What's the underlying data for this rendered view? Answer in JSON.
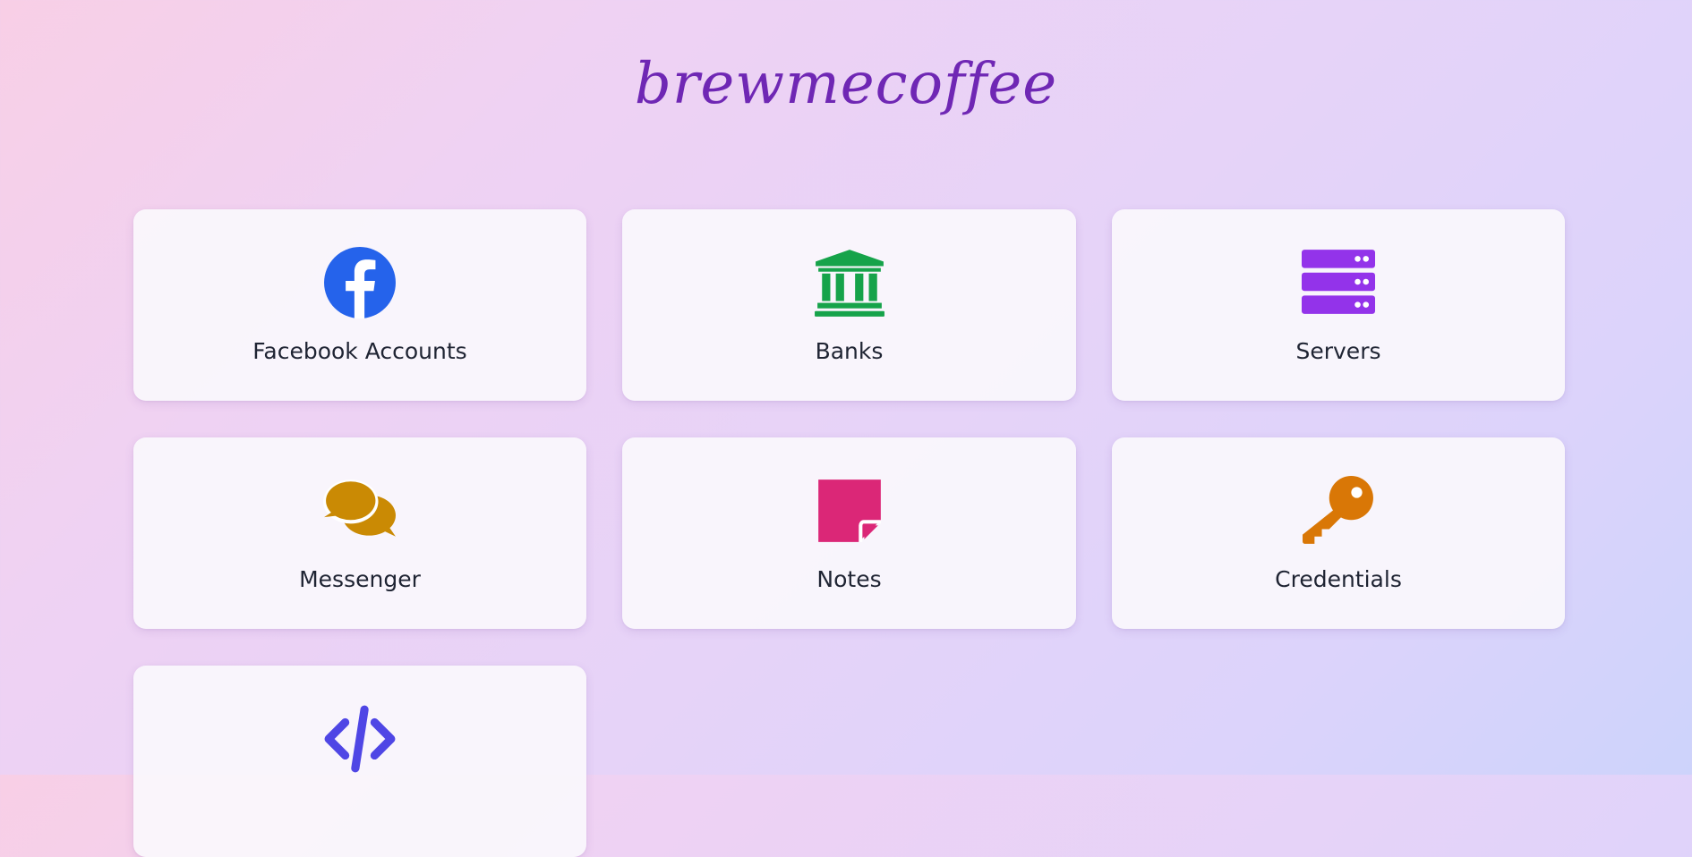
{
  "brand": {
    "title": "brewmecoffee",
    "color": "#6f27b4"
  },
  "cards": [
    {
      "label": "Facebook Accounts",
      "icon": "facebook-icon",
      "color": "#2563eb"
    },
    {
      "label": "Banks",
      "icon": "bank-icon",
      "color": "#16a34a"
    },
    {
      "label": "Servers",
      "icon": "server-icon",
      "color": "#9333ea"
    },
    {
      "label": "Messenger",
      "icon": "chat-bubbles-icon",
      "color": "#ca8a04"
    },
    {
      "label": "Notes",
      "icon": "sticky-note-icon",
      "color": "#db2777"
    },
    {
      "label": "Credentials",
      "icon": "key-icon",
      "color": "#d97706"
    },
    {
      "label": "",
      "icon": "code-icon",
      "color": "#4f46e5"
    }
  ]
}
